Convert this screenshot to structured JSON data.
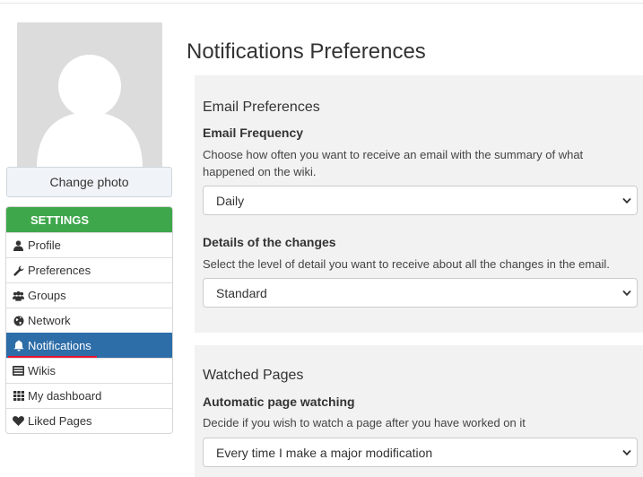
{
  "sidebar": {
    "change_photo_label": "Change photo",
    "settings_title": "SETTINGS",
    "items": [
      {
        "label": "Profile",
        "icon": "user-icon"
      },
      {
        "label": "Preferences",
        "icon": "wrench-icon"
      },
      {
        "label": "Groups",
        "icon": "users-icon"
      },
      {
        "label": "Network",
        "icon": "globe-icon"
      },
      {
        "label": "Notifications",
        "icon": "bell-icon",
        "active": true
      },
      {
        "label": "Wikis",
        "icon": "list-icon"
      },
      {
        "label": "My dashboard",
        "icon": "grid-icon"
      },
      {
        "label": "Liked Pages",
        "icon": "heart-icon"
      }
    ]
  },
  "main": {
    "title": "Notifications Preferences",
    "email": {
      "section_title": "Email Preferences",
      "frequency": {
        "label": "Email Frequency",
        "help": "Choose how often you want to receive an email with the summary of what happened on the wiki.",
        "value": "Daily"
      },
      "details": {
        "label": "Details of the changes",
        "help": "Select the level of detail you want to receive about all the changes in the email.",
        "value": "Standard"
      }
    },
    "watched": {
      "section_title": "Watched Pages",
      "auto": {
        "label": "Automatic page watching",
        "help": "Decide if you wish to watch a page after you have worked on it",
        "value": "Every time I make a major modification"
      }
    }
  },
  "colors": {
    "settings_header": "#3ea74b",
    "active_item": "#2d6da8",
    "active_underline": "#e8122c",
    "panel_bg": "#f2f2f2"
  }
}
